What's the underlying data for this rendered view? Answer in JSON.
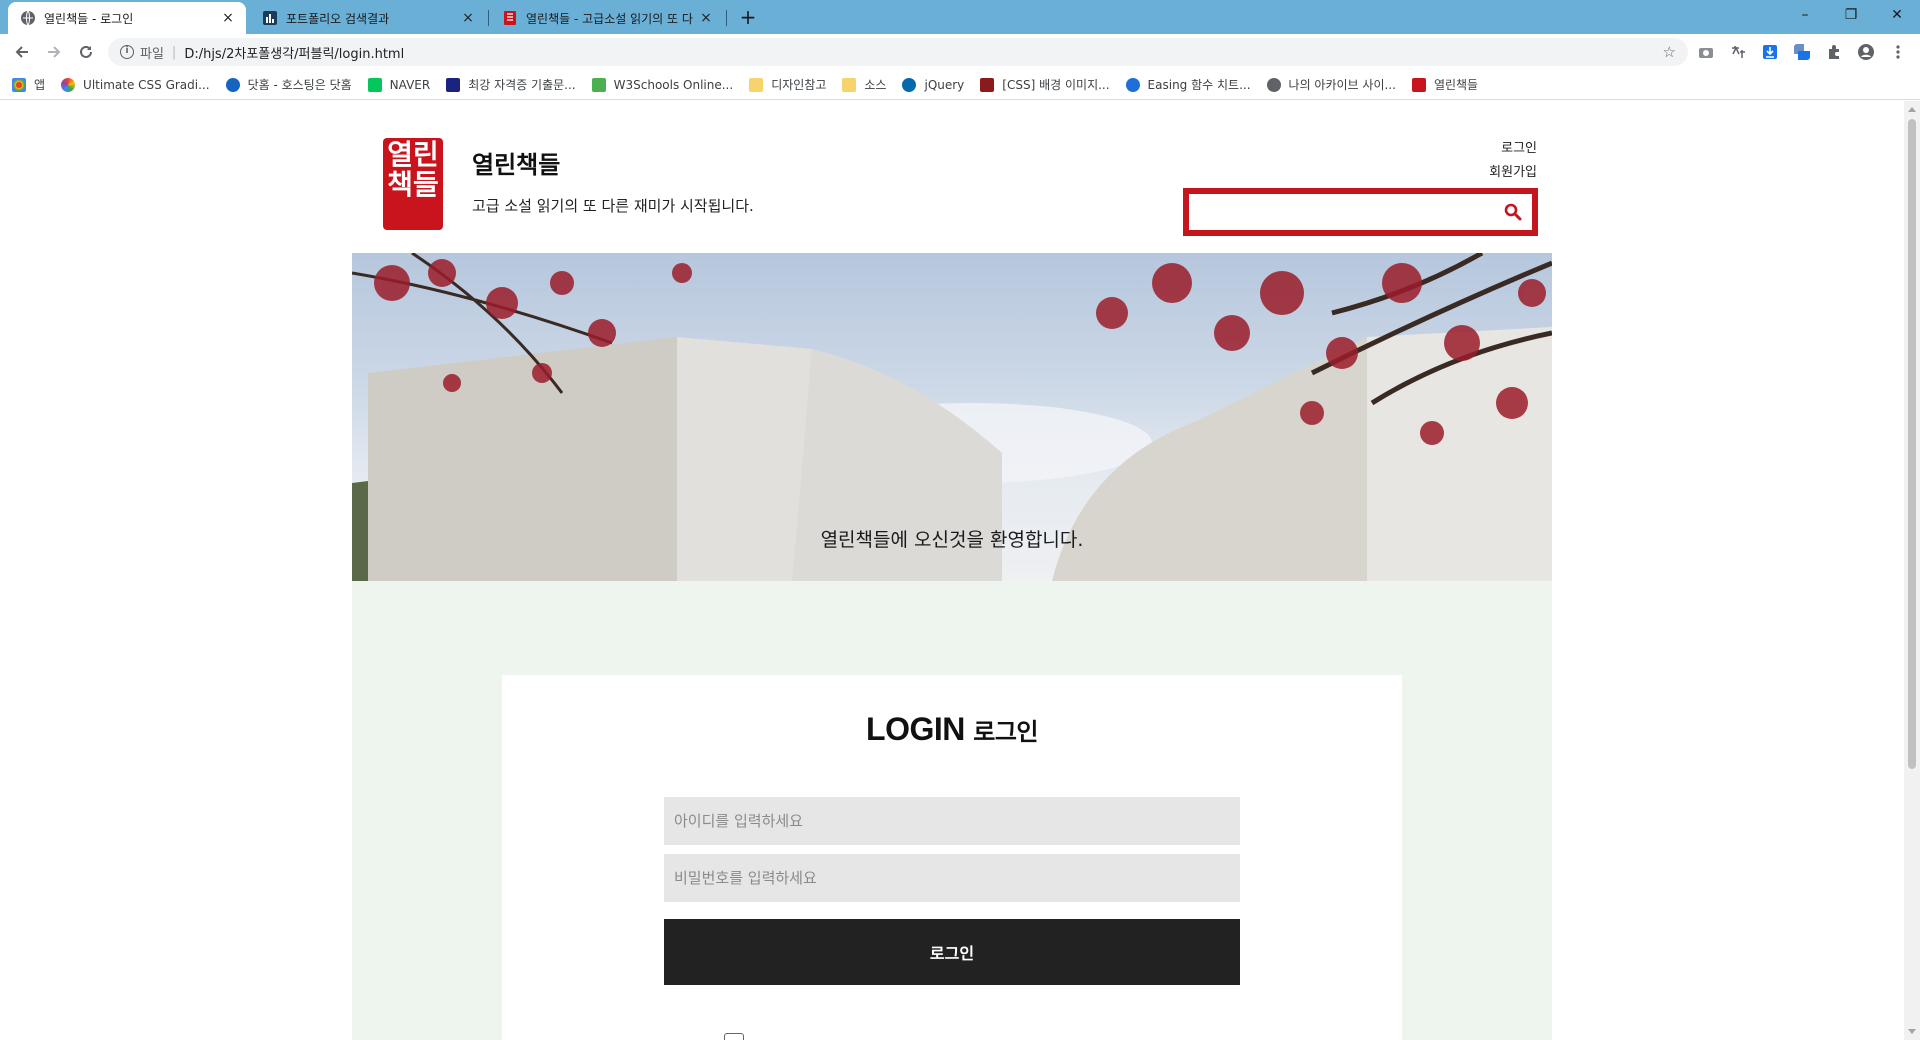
{
  "browser": {
    "tabs": [
      {
        "title": "열린책들 - 로그인",
        "close": "×"
      },
      {
        "title": "포트폴리오 검색결과",
        "close": "×"
      },
      {
        "title": "열린책들 - 고급소설 읽기의 또 다",
        "close": "×"
      }
    ],
    "new_tab": "+",
    "window_controls": {
      "minimize": "–",
      "restore": "❐",
      "close": "✕"
    },
    "address": {
      "scheme": "파일",
      "url": "D:/hjs/2차포폴생각/퍼블릭/login.html"
    },
    "bookmarks": [
      {
        "label": "앱",
        "color": "#e94235"
      },
      {
        "label": "Ultimate CSS Gradi...",
        "color": "#8e44ad"
      },
      {
        "label": "닷홈 - 호스팅은 닷홈",
        "color": "#1565c0"
      },
      {
        "label": "NAVER",
        "color": "#03c75a"
      },
      {
        "label": "최강 자격증 기출문...",
        "color": "#1a237e"
      },
      {
        "label": "W3Schools Online...",
        "color": "#4caf50"
      },
      {
        "label": "디자인참고",
        "color": "#f6d36b"
      },
      {
        "label": "소스",
        "color": "#f6d36b"
      },
      {
        "label": "jQuery",
        "color": "#0769ad"
      },
      {
        "label": "[CSS] 배경 이미지...",
        "color": "#8b1a1a"
      },
      {
        "label": "Easing 함수 치트...",
        "color": "#1e6fd9"
      },
      {
        "label": "나의 아카이브 사이...",
        "color": "#5f6368"
      },
      {
        "label": "열린책들",
        "color": "#c9141d"
      }
    ]
  },
  "site": {
    "logo_text": "열린책들",
    "title": "열린책들",
    "tagline": "고급 소설 읽기의 또 다른 재미가 시작됩니다.",
    "links": {
      "login": "로그인",
      "signup": "회원가입"
    },
    "search": {
      "placeholder": ""
    },
    "hero_caption": "열린책들에 오신것을 환영합니다.",
    "brand_color": "#c4161c"
  },
  "login": {
    "title_en": "LOGIN",
    "title_ko": "로그인",
    "id_placeholder": "아이디를 입력하세요",
    "pw_placeholder": "비밀번호를 입력하세요",
    "submit": "로그인"
  }
}
